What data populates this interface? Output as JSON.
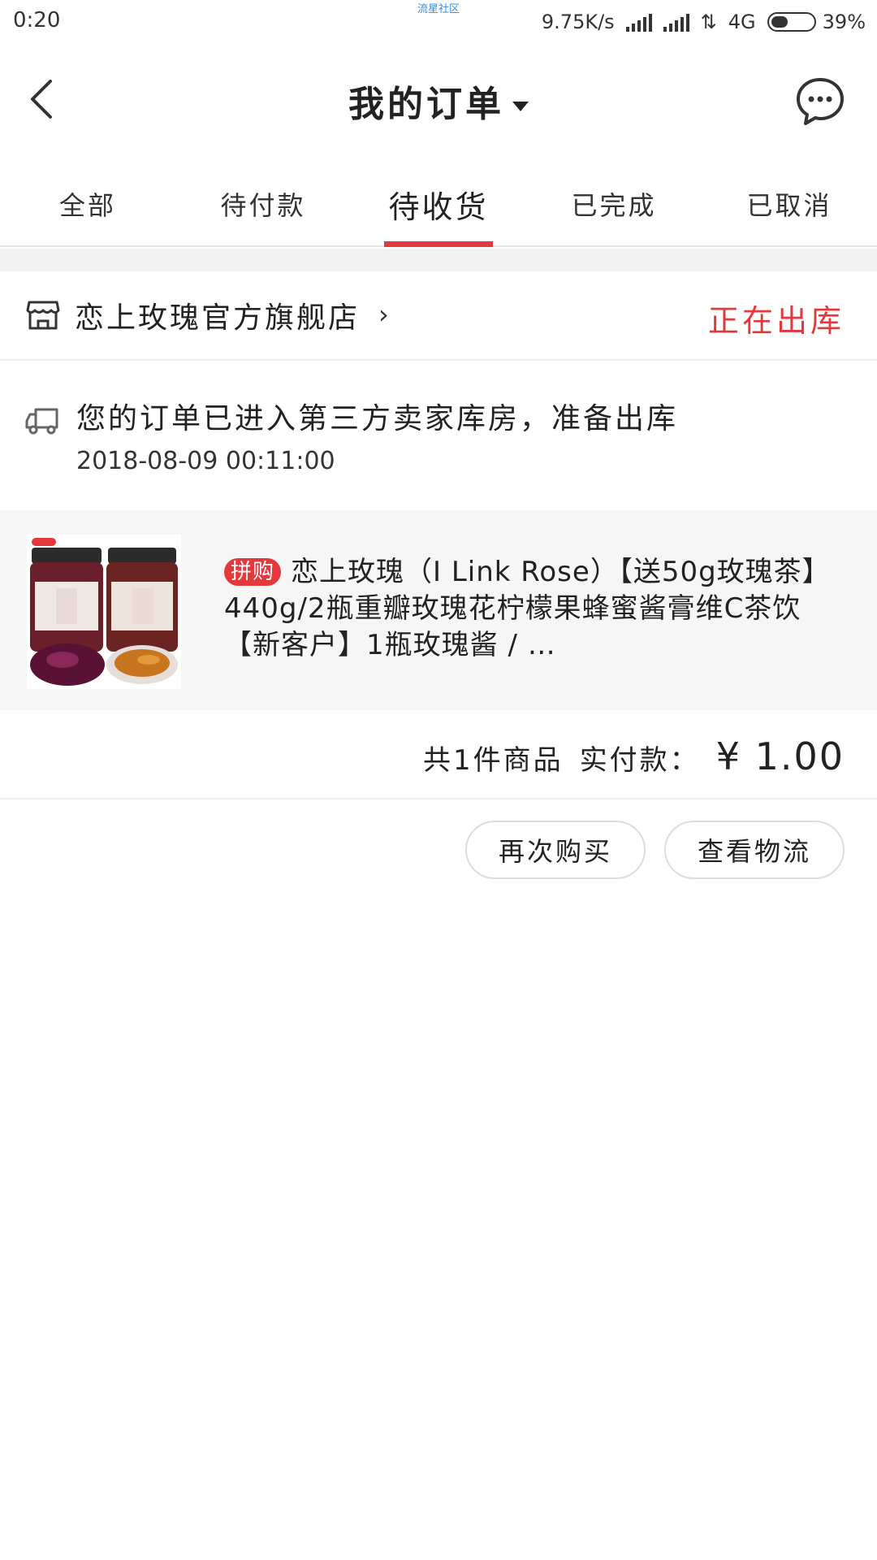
{
  "status_bar": {
    "time": "0:20",
    "notice": "流星社区",
    "speed": "9.75K/s",
    "network": "4G",
    "battery": "39%",
    "battery_level": 0.39
  },
  "header": {
    "title": "我的订单",
    "back_icon": "chevron-left-icon",
    "message_icon": "chat-bubble-icon"
  },
  "tabs": [
    {
      "label": "全部",
      "active": false
    },
    {
      "label": "待付款",
      "active": false
    },
    {
      "label": "待收货",
      "active": true
    },
    {
      "label": "已完成",
      "active": false
    },
    {
      "label": "已取消",
      "active": false
    }
  ],
  "order": {
    "shop_name": "恋上玫瑰官方旗舰店",
    "shop_chevron": "›",
    "status": "正在出库",
    "logistics_text": "您的订单已进入第三方卖家库房，准备出库",
    "logistics_time": "2018-08-09 00:11:00",
    "product_badge": "拼购",
    "product_title": "恋上玫瑰（I Link Rose）【送50g玫瑰茶】440g/2瓶重瓣玫瑰花柠檬果蜂蜜酱膏维C茶饮【新客户】1瓶玫瑰酱 / …",
    "item_count": "共1件商品",
    "paid_label": "实付款：",
    "paid_amount": "¥ 1.00",
    "buttons": {
      "rebuy": "再次购买",
      "logistics": "查看物流"
    }
  },
  "colors": {
    "accent": "#e4393c",
    "band": "#f2f2f5",
    "product_bg": "#f6f6f6"
  }
}
